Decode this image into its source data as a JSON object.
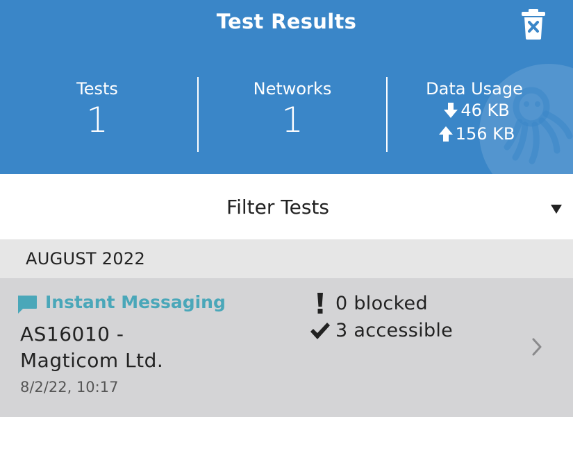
{
  "header": {
    "title": "Test Results",
    "delete_icon": "trash-x-icon",
    "watermark_icon": "octopus-logo",
    "background_color": "#3a86c8"
  },
  "stats": {
    "tests": {
      "label": "Tests",
      "value": "1"
    },
    "networks": {
      "label": "Networks",
      "value": "1"
    },
    "data_usage": {
      "label": "Data Usage",
      "download": "46 KB",
      "upload": "156 KB",
      "download_icon": "arrow-down-icon",
      "upload_icon": "arrow-up-icon"
    }
  },
  "filter": {
    "label": "Filter Tests",
    "dropdown_icon": "triangle-down-icon"
  },
  "sections": [
    {
      "month": "AUGUST 2022",
      "tests": [
        {
          "type": "Instant Messaging",
          "type_icon": "chat-bubble-icon",
          "type_color": "#4aa7b9",
          "network_line1": "AS16010 -",
          "network_line2": "Magticom Ltd.",
          "date": "8/2/22, 10:17",
          "blocked": "0 blocked",
          "accessible": "3 accessible",
          "blocked_icon": "exclamation-icon",
          "accessible_icon": "checkmark-icon",
          "chevron_icon": "chevron-right-icon"
        }
      ]
    }
  ]
}
